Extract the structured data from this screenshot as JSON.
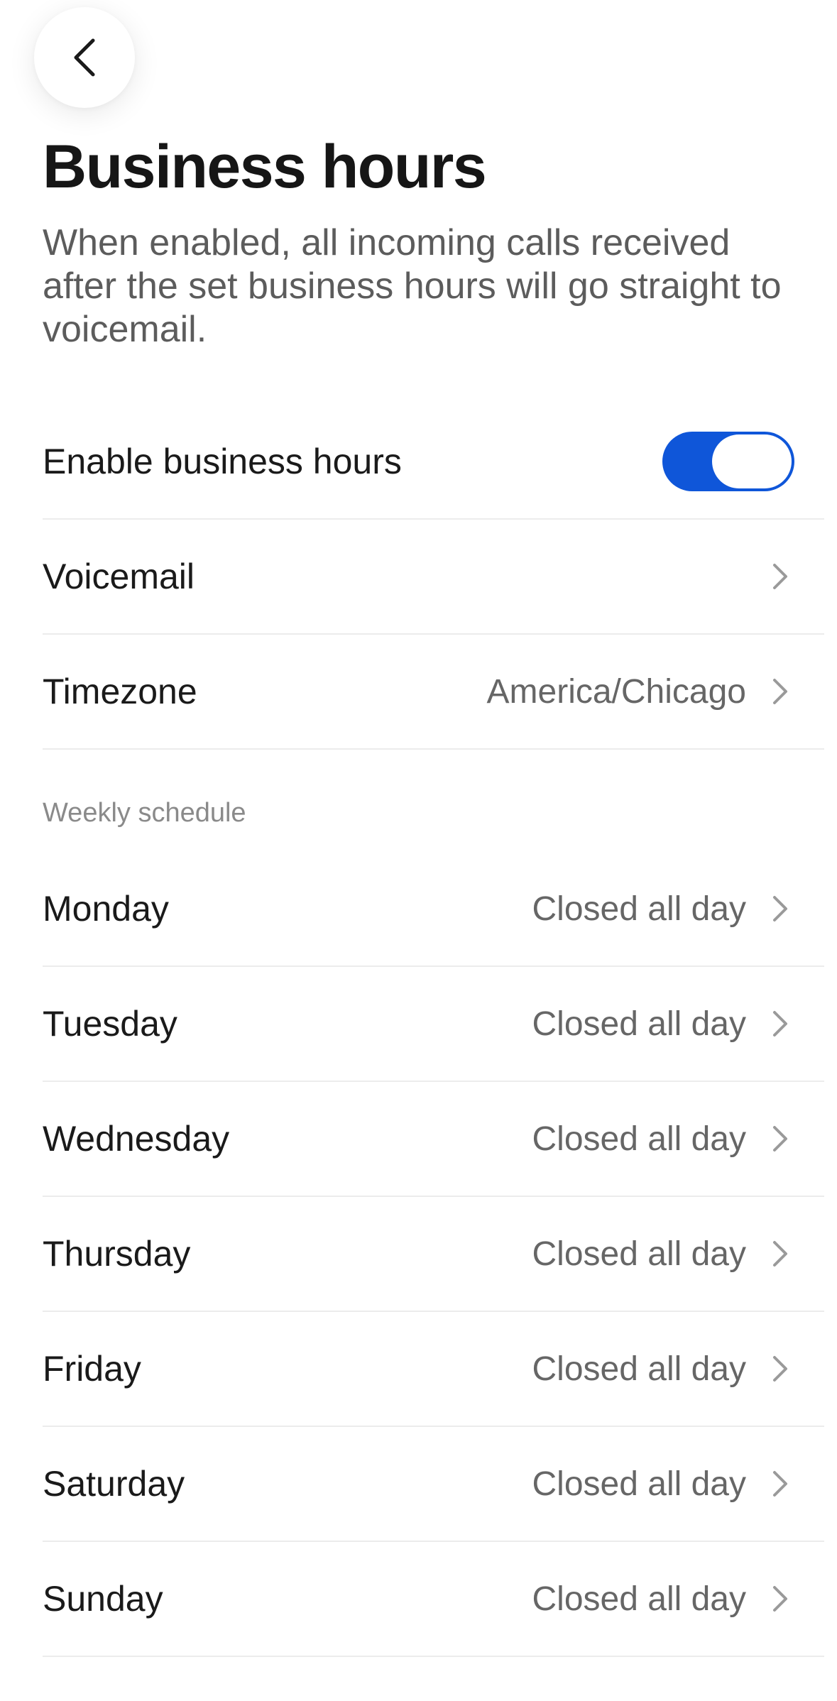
{
  "header": {
    "title": "Business hours",
    "description": "When enabled, all incoming calls received after the set business hours will go straight to voicemail."
  },
  "settings": {
    "enable_label": "Enable business hours",
    "enable_on": true,
    "voicemail_label": "Voicemail",
    "timezone_label": "Timezone",
    "timezone_value": "America/Chicago"
  },
  "schedule": {
    "section_title": "Weekly schedule",
    "days": [
      {
        "label": "Monday",
        "value": "Closed all day"
      },
      {
        "label": "Tuesday",
        "value": "Closed all day"
      },
      {
        "label": "Wednesday",
        "value": "Closed all day"
      },
      {
        "label": "Thursday",
        "value": "Closed all day"
      },
      {
        "label": "Friday",
        "value": "Closed all day"
      },
      {
        "label": "Saturday",
        "value": "Closed all day"
      },
      {
        "label": "Sunday",
        "value": "Closed all day"
      }
    ]
  },
  "colors": {
    "accent": "#0f56d9",
    "divider": "#ececec",
    "secondary_text": "#666666"
  },
  "icons": {
    "back": "chevron-left-icon",
    "row": "chevron-right-icon"
  }
}
